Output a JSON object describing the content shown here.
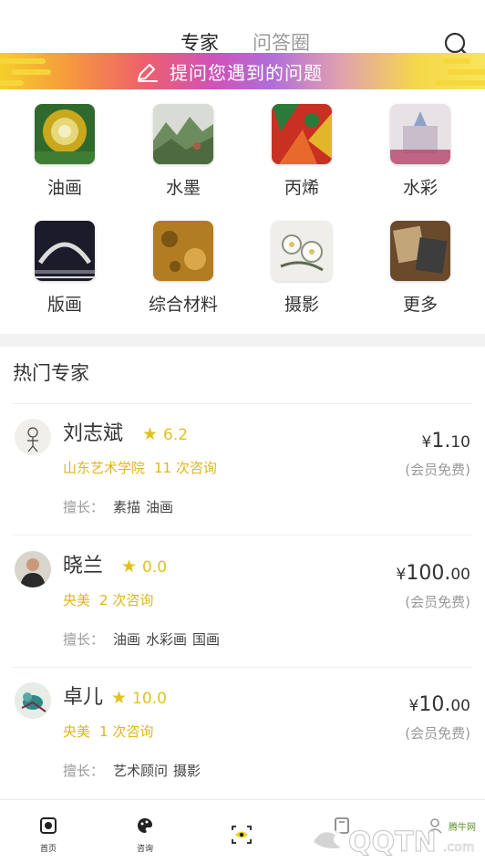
{
  "header": {
    "tabs": [
      {
        "label": "专家",
        "active": true
      },
      {
        "label": "问答圈",
        "active": false
      }
    ]
  },
  "banner": {
    "text": "提问您遇到的问题",
    "icon": "pencil-icon"
  },
  "categories": [
    {
      "label": "油画",
      "thumb_colors": [
        "#c9a81b",
        "#2f6a2c",
        "#e6d77a"
      ]
    },
    {
      "label": "水墨",
      "thumb_colors": [
        "#d8dcd5",
        "#6d8c5d",
        "#b05a48"
      ]
    },
    {
      "label": "丙烯",
      "thumb_colors": [
        "#c83022",
        "#2a7a3a",
        "#e2b62b"
      ]
    },
    {
      "label": "水彩",
      "thumb_colors": [
        "#e8e2e6",
        "#b7436b",
        "#8da4c8"
      ]
    },
    {
      "label": "版画",
      "thumb_colors": [
        "#1c1b2a",
        "#dcdcdc",
        "#6d6d7a"
      ]
    },
    {
      "label": "综合材料",
      "thumb_colors": [
        "#b27c22",
        "#7a5514",
        "#d9a84a"
      ]
    },
    {
      "label": "摄影",
      "thumb_colors": [
        "#f0eeea",
        "#8a8f80",
        "#d8c46a"
      ]
    },
    {
      "label": "更多",
      "thumb_colors": [
        "#6b4a2c",
        "#c2a67a",
        "#3d3d3d"
      ]
    }
  ],
  "hot_experts": {
    "title": "热门专家",
    "skills_label": "擅长：",
    "items": [
      {
        "name": "刘志斌",
        "rating": "6.2",
        "org": "山东艺术学院",
        "consults": "11 次咨询",
        "skills": [
          "素描",
          "油画"
        ],
        "price_currency": "¥",
        "price_int": "1.",
        "price_dec": "10",
        "free_text": "(会员免费)"
      },
      {
        "name": "晓兰",
        "rating": "0.0",
        "org": "央美",
        "consults": "2 次咨询",
        "skills": [
          "油画",
          "水彩画",
          "国画"
        ],
        "price_currency": "¥",
        "price_int": "100.",
        "price_dec": "00",
        "free_text": "(会员免费)"
      },
      {
        "name": "卓儿",
        "rating": "10.0",
        "org": "央美",
        "consults": "1 次咨询",
        "skills": [
          "艺术顾问",
          "摄影"
        ],
        "price_currency": "¥",
        "price_int": "10.",
        "price_dec": "00",
        "free_text": "(会员免费)"
      }
    ]
  },
  "bottom_nav": [
    {
      "label": "首页",
      "icon": "home-icon"
    },
    {
      "label": "咨询",
      "icon": "palette-icon"
    },
    {
      "label": "",
      "icon": "scan-eye-icon"
    },
    {
      "label": "",
      "icon": "book-icon"
    },
    {
      "label": "",
      "icon": "profile-icon"
    }
  ],
  "watermark": {
    "text": "腾牛网"
  },
  "colors": {
    "accent_yellow": "#e0c21c",
    "meta_gold": "#e0b51c",
    "muted": "#999999",
    "band": "#f2f2f2"
  }
}
